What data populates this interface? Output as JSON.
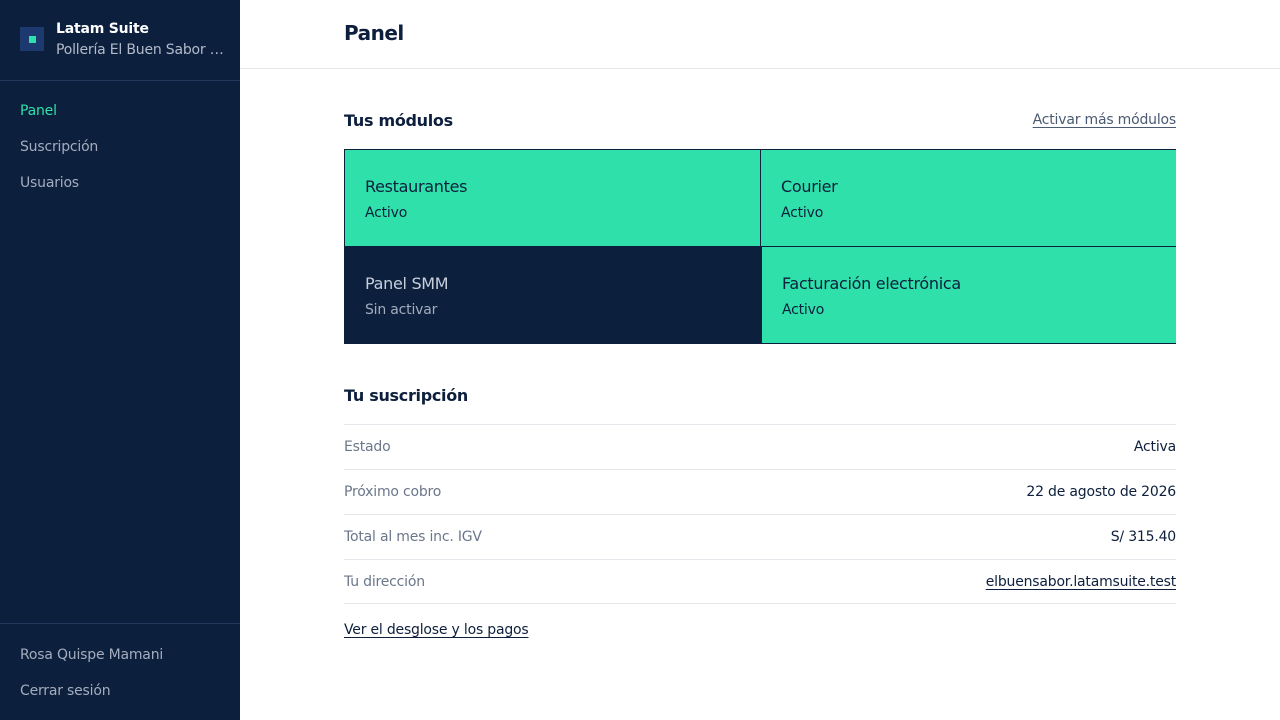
{
  "app": {
    "name": "Latam Suite",
    "business": "Pollería El Buen Sabor S.A.C."
  },
  "sidebar": {
    "items": [
      {
        "label": "Panel",
        "active": true
      },
      {
        "label": "Suscripción",
        "active": false
      },
      {
        "label": "Usuarios",
        "active": false
      }
    ],
    "user_name": "Rosa Quispe Mamani",
    "logout_label": "Cerrar sesión"
  },
  "header": {
    "title": "Panel"
  },
  "modules_section": {
    "title": "Tus módulos",
    "activate_link": "Activar más módulos",
    "modules": [
      {
        "name": "Restaurantes",
        "status": "Activo"
      },
      {
        "name": "Courier",
        "status": "Activo"
      },
      {
        "name": "Panel SMM",
        "status": "Sin activar"
      },
      {
        "name": "Facturación electrónica",
        "status": "Activo"
      }
    ]
  },
  "subscription": {
    "title": "Tu suscripción",
    "rows": [
      {
        "label": "Estado",
        "value": "Activa"
      },
      {
        "label": "Próximo cobro",
        "value": "22 de agosto de 2026"
      },
      {
        "label": "Total al mes inc. IGV",
        "value": "S/ 315.40"
      },
      {
        "label": "Tu dirección",
        "value": "elbuensabor.latamsuite.test"
      }
    ],
    "details_link": "Ver el desglose y los pagos"
  },
  "colors": {
    "sidebar_bg": "#0c1f3c",
    "accent": "#2fe0aa",
    "text_dark": "#0d1f3c"
  },
  "icons": {
    "logo": "latam-suite-logo-icon"
  }
}
